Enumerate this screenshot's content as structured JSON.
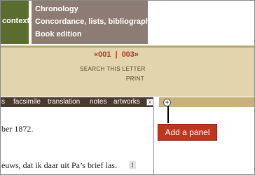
{
  "nav": {
    "left_label": "context",
    "items": [
      "Chronology",
      "Concordance, lists, bibliography",
      "Book edition"
    ]
  },
  "pager": {
    "prev": "«001",
    "separator": "|",
    "next": "003»"
  },
  "letter_tools": {
    "search": "SEARCH THIS LETTER",
    "print": "PRINT"
  },
  "tabs": [
    "s",
    "facsimile",
    "translation",
    "notes",
    "artworks"
  ],
  "tab_close": "x",
  "add_panel": {
    "button": "+",
    "callout": "Add a panel"
  },
  "letter": {
    "line1": "ber 1872.",
    "line2": "euws, dat ik daar uit Pa’s brief las.",
    "line_marker": "1"
  },
  "colors": {
    "nav_green": "#5a6c2e",
    "nav_taupe": "#8c7c73",
    "band": "#e2d5ad",
    "tabbar": "#4a3a2e",
    "accent_red": "#c0351e"
  }
}
